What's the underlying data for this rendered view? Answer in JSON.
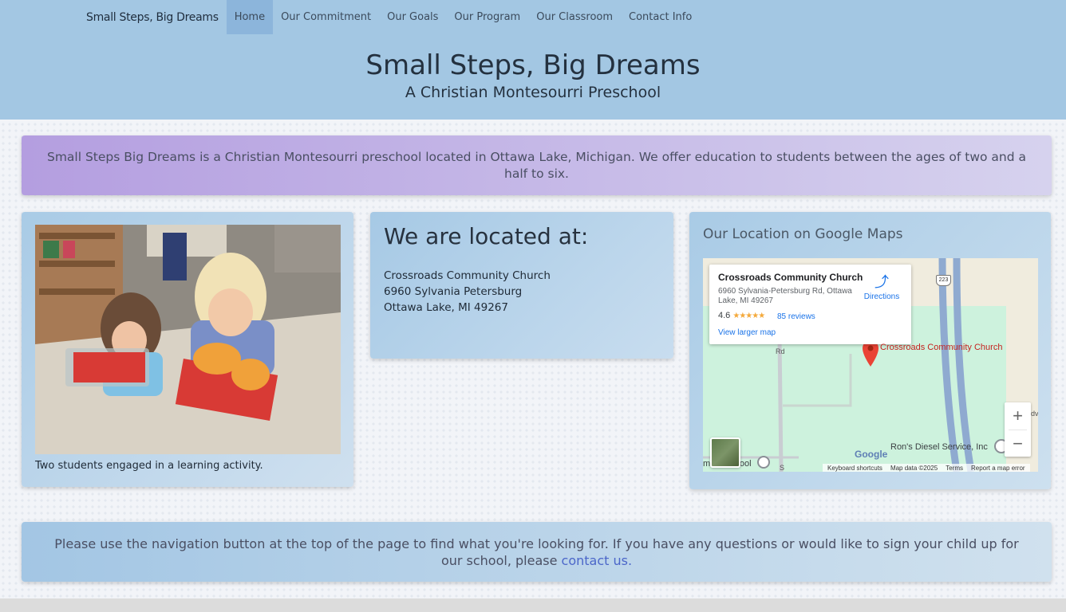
{
  "nav": {
    "brand": "Small Steps, Big Dreams",
    "items": [
      {
        "label": "Home",
        "active": true
      },
      {
        "label": "Our Commitment",
        "active": false
      },
      {
        "label": "Our Goals",
        "active": false
      },
      {
        "label": "Our Program",
        "active": false
      },
      {
        "label": "Our Classroom",
        "active": false
      },
      {
        "label": "Contact Info",
        "active": false
      }
    ]
  },
  "header": {
    "title": "Small Steps, Big Dreams",
    "subtitle": "A Christian Montesourri Preschool"
  },
  "intro": {
    "text": "Small Steps Big Dreams is a Christian Montesourri preschool located in Ottawa Lake, Michigan. We offer education to students between the ages of two and a half to six."
  },
  "photo": {
    "caption": "Two students engaged in a learning activity."
  },
  "location": {
    "heading": "We are located at:",
    "line1": "Crossroads Community Church",
    "line2": "6960 Sylvania Petersburg",
    "line3": "Ottawa Lake, MI 49267"
  },
  "map": {
    "heading": "Our Location on Google Maps",
    "place_name": "Crossroads Community Church",
    "place_address": "6960 Sylvania-Petersburg Rd, Ottawa Lake, MI 49267",
    "rating": "4.6",
    "stars": "★★★★★",
    "reviews": "85 reviews",
    "directions": "Directions",
    "larger_map": "View larger map",
    "pin_label": "Crossroads Community Church",
    "nearby_1": "Ron's Diesel Service, Inc",
    "nearby_2": "mbia School",
    "road_label": "Rd",
    "road_label_2": "S",
    "highway": "223",
    "partial_label": "dv",
    "zoom_in": "+",
    "zoom_out": "−",
    "logo": "Google",
    "attribution": [
      "Keyboard shortcuts",
      "Map data ©2025",
      "Terms",
      "Report a map error"
    ],
    "pin_color": "#ea4335"
  },
  "footer": {
    "text": "Please use the navigation button at the top of the page to find what you're looking for. If you have any questions or would like to sign your child up for our school, please ",
    "link": "contact us."
  },
  "colors": {
    "header_bg": "#a3c7e3",
    "active_nav": "#8cb5db",
    "intro_gradient_start": "#b49ee0",
    "link": "#4b66c9"
  }
}
